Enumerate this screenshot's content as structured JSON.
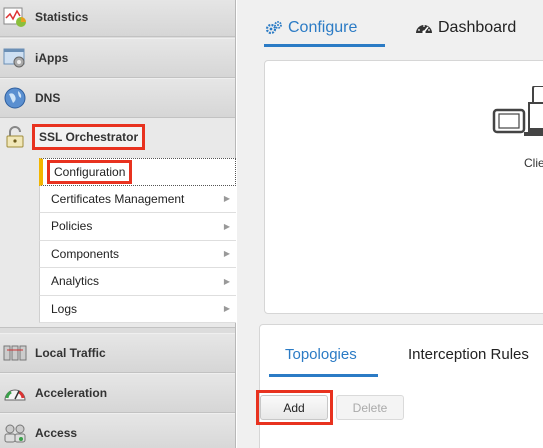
{
  "sidebar": {
    "items": [
      {
        "label": "Statistics",
        "icon": "statistics-icon"
      },
      {
        "label": "iApps",
        "icon": "iapps-icon"
      },
      {
        "label": "DNS",
        "icon": "globe-icon"
      },
      {
        "label": "SSL Orchestrator",
        "icon": "padlock-icon"
      },
      {
        "label": "Local Traffic",
        "icon": "local-traffic-icon"
      },
      {
        "label": "Acceleration",
        "icon": "gauge-icon"
      },
      {
        "label": "Access",
        "icon": "access-icon"
      }
    ],
    "ssl_submenu": [
      {
        "label": "Configuration"
      },
      {
        "label": "Certificates Management"
      },
      {
        "label": "Policies"
      },
      {
        "label": "Components"
      },
      {
        "label": "Analytics"
      },
      {
        "label": "Logs"
      }
    ]
  },
  "main": {
    "top_tabs": [
      {
        "label": "Configure",
        "icon": "gears-icon"
      },
      {
        "label": "Dashboard",
        "icon": "dashboard-icon"
      }
    ],
    "diagram_label": "Clie",
    "bottom_tabs": [
      {
        "label": "Topologies"
      },
      {
        "label": "Interception Rules"
      }
    ],
    "buttons": {
      "add": "Add",
      "delete": "Delete"
    }
  },
  "colors": {
    "accent": "#2b7bc5",
    "highlight": "#e8321f",
    "active_marker": "#f3b600"
  }
}
